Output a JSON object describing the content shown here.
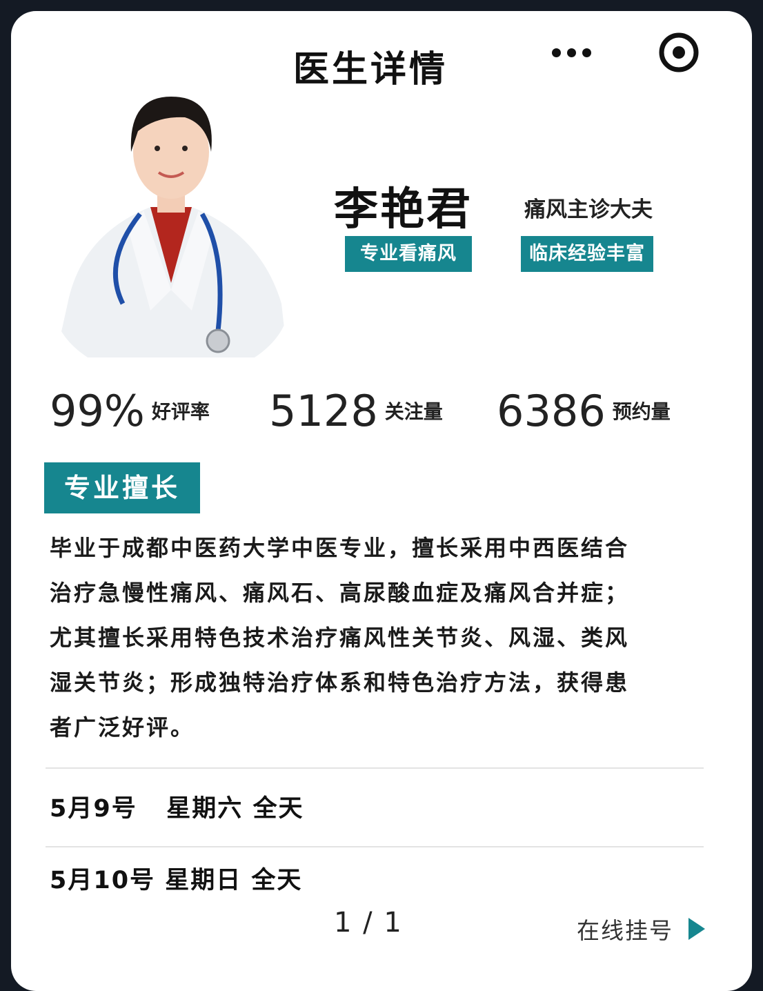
{
  "header": {
    "title": "医生详情",
    "more_icon": "more-dots-icon",
    "target_icon": "target-icon"
  },
  "doctor": {
    "name": "李艳君",
    "role": "痛风主诊大夫",
    "tags": [
      "专业看痛风",
      "临床经验丰富"
    ]
  },
  "stats": [
    {
      "value": "99%",
      "label": "好评率"
    },
    {
      "value": "5128",
      "label": "关注量"
    },
    {
      "value": "6386",
      "label": "预约量"
    }
  ],
  "specialty": {
    "heading": "专业擅长",
    "lines": [
      "毕业于成都中医药大学中医专业，擅长采用中西医结合",
      "治疗急慢性痛风、痛风石、高尿酸血症及痛风合并症；",
      "尤其擅长采用特色技术治疗痛风性关节炎、风湿、类风",
      "湿关节炎；形成独特治疗体系和特色治疗方法，获得患",
      "者广泛好评。"
    ]
  },
  "schedule": [
    {
      "text": "5月9号   星期六 全天"
    },
    {
      "text": "5月10号 星期日 全天"
    }
  ],
  "footer": {
    "pager": "1 / 1",
    "book_label": "在线挂号",
    "accent": "#16868f"
  }
}
